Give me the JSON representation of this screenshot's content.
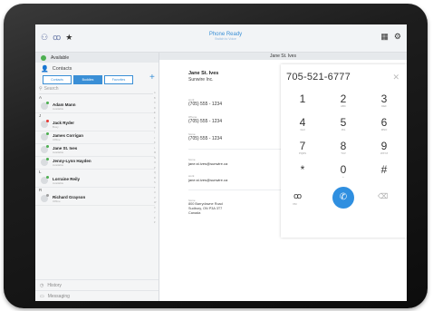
{
  "topbar": {
    "app_title": "Phone Ready",
    "app_subtitle": "Switch to Voice",
    "voicemail_icon": "voicemail-icon",
    "favorites_icon": "star-icon"
  },
  "sidebar": {
    "availability": "Available",
    "contacts_label": "Contacts",
    "tabs": [
      "Contacts",
      "Buddies",
      "Favorites"
    ],
    "search_placeholder": "Search",
    "groups": [
      {
        "letter": "A",
        "contacts": [
          {
            "name": "Adam Mann",
            "status": "Available",
            "presence": "#4caf50"
          }
        ]
      },
      {
        "letter": "J",
        "contacts": [
          {
            "name": "Jack Ryder",
            "status": "Busy",
            "presence": "#e53935"
          },
          {
            "name": "James Corrigan",
            "status": "Offline",
            "presence": "#4caf50"
          },
          {
            "name": "Jane St. Ives",
            "status": "Available",
            "presence": "#4caf50"
          },
          {
            "name": "Jenny-Lynn Hayden",
            "status": "Available",
            "presence": "#4caf50"
          }
        ]
      },
      {
        "letter": "L",
        "contacts": [
          {
            "name": "Lorraine Reily",
            "status": "Available",
            "presence": "#4caf50"
          }
        ]
      },
      {
        "letter": "R",
        "contacts": [
          {
            "name": "Richard Grayson",
            "status": "Offline",
            "presence": "#9e9e9e"
          }
        ]
      }
    ],
    "alphabet": [
      "A",
      "B",
      "C",
      "D",
      "E",
      "F",
      "G",
      "H",
      "I",
      "J",
      "K",
      "L",
      "M",
      "N",
      "O",
      "P",
      "Q",
      "R",
      "S",
      "T",
      "U",
      "V",
      "W",
      "X",
      "Y",
      "Z",
      "#"
    ],
    "bottom_items": [
      "History",
      "Messaging"
    ]
  },
  "detail": {
    "header": "Jane St. Ives",
    "name": "Jane St. Ives",
    "company": "Sunwire Inc.",
    "fields": [
      {
        "label": "work",
        "value": "(705) 555 - 1234"
      },
      {
        "label": "iPhone",
        "value": "(705) 555 - 1234"
      },
      {
        "label": "home",
        "value": "(705) 555 - 1234"
      }
    ],
    "emails": [
      {
        "label": "home",
        "value": "jane.st.ives@sunwire.ca"
      },
      {
        "label": "work",
        "value": "jane.st.ives@sunwire.ca"
      }
    ],
    "address": {
      "label": "home",
      "lines": [
        "800 Barrydowne Road",
        "Sudbury, ON P3A 3T7",
        "Canada"
      ]
    }
  },
  "dialer": {
    "number": "705-521-6777",
    "keys": [
      {
        "digit": "1",
        "letters": ""
      },
      {
        "digit": "2",
        "letters": "ABC"
      },
      {
        "digit": "3",
        "letters": "DEF"
      },
      {
        "digit": "4",
        "letters": "GHI"
      },
      {
        "digit": "5",
        "letters": "JKL"
      },
      {
        "digit": "6",
        "letters": "MNO"
      },
      {
        "digit": "7",
        "letters": "PQRS"
      },
      {
        "digit": "8",
        "letters": "TUV"
      },
      {
        "digit": "9",
        "letters": "WXYZ"
      },
      {
        "digit": "*",
        "letters": ""
      },
      {
        "digit": "0",
        "letters": "+"
      },
      {
        "digit": "#",
        "letters": ""
      }
    ],
    "voicemail_label": "VM",
    "accent": "#2f8fe0"
  }
}
